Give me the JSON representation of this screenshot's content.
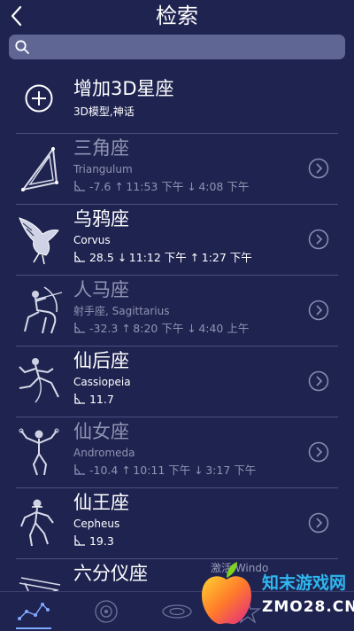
{
  "header": {
    "title": "检索"
  },
  "search": {
    "placeholder": "",
    "value": ""
  },
  "add_row": {
    "title": "增加3D星座",
    "subtitle": "3D模型,神话"
  },
  "list": [
    {
      "name": "三角座",
      "sub": "Triangulum",
      "alt": "-7.6",
      "first_dir": "↑",
      "first_time": "11:53 下午",
      "second_dir": "↓",
      "second_time": "4:08 下午",
      "dim": true
    },
    {
      "name": "乌鸦座",
      "sub": "Corvus",
      "alt": "28.5",
      "first_dir": "↓",
      "first_time": "11:12 下午",
      "second_dir": "↑",
      "second_time": "1:27 下午",
      "dim": false
    },
    {
      "name": "人马座",
      "sub": "射手座, Sagittarius",
      "alt": "-32.3",
      "first_dir": "↑",
      "first_time": "8:20 下午",
      "second_dir": "↓",
      "second_time": "4:40 上午",
      "dim": true
    },
    {
      "name": "仙后座",
      "sub": "Cassiopeia",
      "alt": "11.7",
      "first_dir": "",
      "first_time": "",
      "second_dir": "",
      "second_time": "",
      "dim": false
    },
    {
      "name": "仙女座",
      "sub": "Andromeda",
      "alt": "-10.4",
      "first_dir": "↑",
      "first_time": "10:11 下午",
      "second_dir": "↓",
      "second_time": "3:17 下午",
      "dim": true
    },
    {
      "name": "仙王座",
      "sub": "Cepheus",
      "alt": "19.3",
      "first_dir": "",
      "first_time": "",
      "second_dir": "",
      "second_time": "",
      "dim": false
    },
    {
      "name": "六分仪座",
      "sub": "",
      "alt": "",
      "first_dir": "",
      "first_time": "",
      "second_dir": "",
      "second_time": "",
      "dim": false
    }
  ],
  "watermark": {
    "brand": "知末游戏网",
    "domain": "ZMO28.CN",
    "overlay": "激活 Windo"
  },
  "icons": {
    "back": "chevron-left-icon",
    "search": "search-icon",
    "add": "plus-circle-icon",
    "row_detail": "chevron-right-circle-icon",
    "altitude": "angle-icon",
    "tab1": "constellation-icon",
    "tab2": "orbit-icon",
    "tab3": "galaxy-icon",
    "tab4": "star-icon"
  },
  "colors": {
    "background": "#1f2350",
    "search_bg": "#5f6694",
    "dim_text": "#9094b2",
    "accent": "#7fa8ff"
  }
}
